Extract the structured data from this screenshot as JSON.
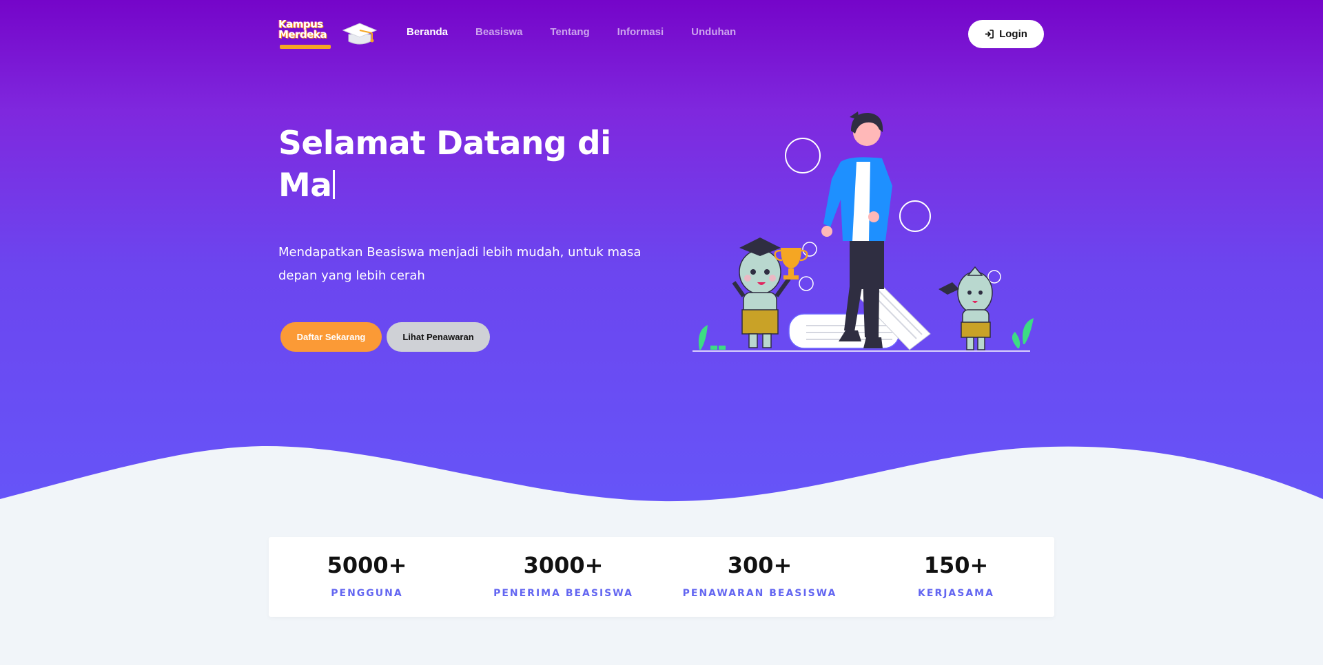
{
  "brand": {
    "logo_text": "Kampus Merdeka",
    "logo_icon": "graduation-cap-icon"
  },
  "nav": {
    "items": [
      {
        "label": "Beranda",
        "active": true
      },
      {
        "label": "Beasiswa",
        "active": false
      },
      {
        "label": "Tentang",
        "active": false
      },
      {
        "label": "Informasi",
        "active": false
      },
      {
        "label": "Unduhan",
        "active": false
      }
    ],
    "login_label": "Login",
    "login_icon": "sign-in-icon"
  },
  "hero": {
    "title": "Selamat Datang di Ma",
    "subtitle": "Mendapatkan Beasiswa menjadi lebih mudah, untuk masa depan yang lebih cerah",
    "primary_button": "Daftar Sekarang",
    "secondary_button": "Lihat Penawaran"
  },
  "stats": [
    {
      "value": "5000+",
      "label": "PENGGUNA"
    },
    {
      "value": "3000+",
      "label": "PENERIMA BEASISWA"
    },
    {
      "value": "300+",
      "label": "PENAWARAN BEASISWA"
    },
    {
      "value": "150+",
      "label": "KERJASAMA"
    }
  ],
  "colors": {
    "hero_top": "#7505c9",
    "hero_bottom": "#6655f8",
    "primary_button": "#fb9a36",
    "secondary_button": "#cfd1d6",
    "stat_label": "#6366f1",
    "page_bg": "#f1f5f9"
  }
}
